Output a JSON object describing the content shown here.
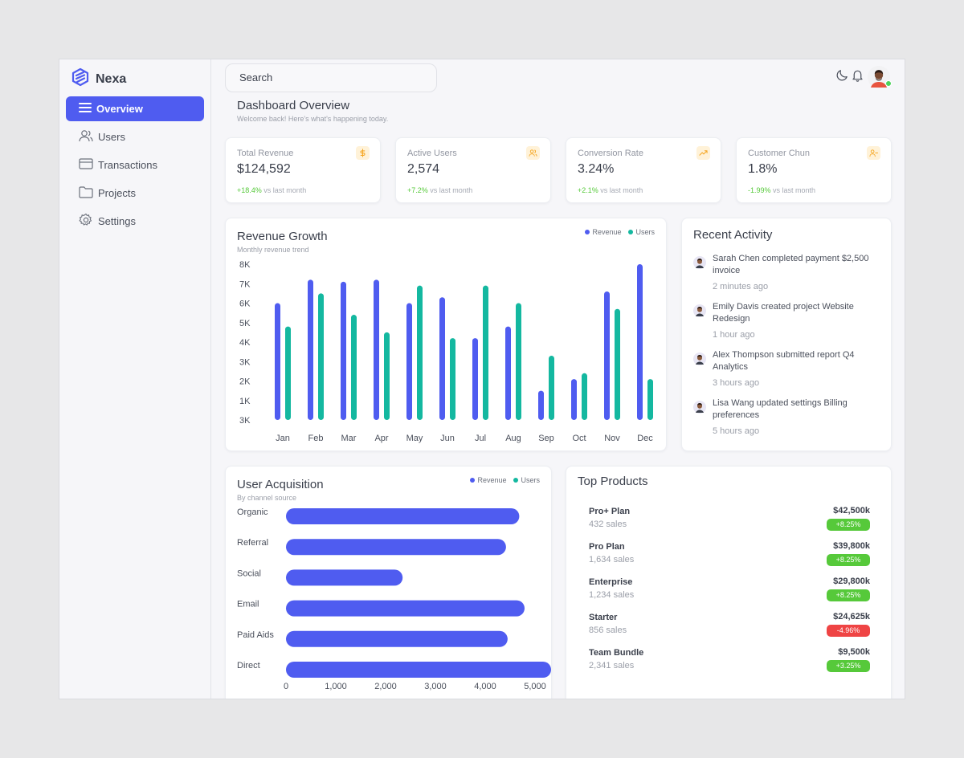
{
  "app": {
    "name": "Nexa"
  },
  "sidebar": {
    "items": [
      {
        "label": "Overview",
        "icon": "menu-icon",
        "active": true
      },
      {
        "label": "Users",
        "icon": "users-icon"
      },
      {
        "label": "Transactions",
        "icon": "credit-card-icon"
      },
      {
        "label": "Projects",
        "icon": "folder-icon"
      },
      {
        "label": "Settings",
        "icon": "gear-icon"
      }
    ]
  },
  "header": {
    "search_placeholder": "Search",
    "icons": [
      "moon-icon",
      "bell-icon",
      "avatar"
    ]
  },
  "page": {
    "title": "Dashboard Overview",
    "subtitle": "Welcome back! Here's what's happening today."
  },
  "stats": [
    {
      "label": "Total Revenue",
      "value": "$124,592",
      "change": "+18.4%",
      "change_suffix": "vs last month",
      "icon": "dollar-icon"
    },
    {
      "label": "Active Users",
      "value": "2,574",
      "change": "+7.2%",
      "change_suffix": "vs last month",
      "icon": "users-icon"
    },
    {
      "label": "Conversion Rate",
      "value": "3.24%",
      "change": "+2.1%",
      "change_suffix": "vs last month",
      "icon": "trending-up-icon"
    },
    {
      "label": "Customer Chun",
      "value": "1.8%",
      "change": "-1.99%",
      "change_suffix": "vs last month",
      "icon": "user-minus-icon"
    }
  ],
  "revenue_chart": {
    "title": "Revenue Growth",
    "subtitle": "Monthly revenue trend",
    "legend": [
      "Revenue",
      "Users"
    ]
  },
  "acquisition_chart": {
    "title": "User Acquisition",
    "subtitle": "By channel source",
    "legend": [
      "Revenue",
      "Users"
    ]
  },
  "chart_data": [
    {
      "type": "bar",
      "title": "Revenue Growth",
      "subtitle": "Monthly revenue trend",
      "categories": [
        "Jan",
        "Feb",
        "Mar",
        "Apr",
        "May",
        "Jun",
        "Jul",
        "Aug",
        "Sep",
        "Oct",
        "Nov",
        "Dec"
      ],
      "y_tick_labels": [
        "8K",
        "7K",
        "6K",
        "5K",
        "4K",
        "3K",
        "2K",
        "1K",
        "3K"
      ],
      "ylim": [
        0,
        8000
      ],
      "series": [
        {
          "name": "Revenue",
          "color": "#4f5cf0",
          "values": [
            6000,
            7200,
            7100,
            7200,
            6000,
            6300,
            4200,
            4800,
            1500,
            2100,
            6600,
            8000
          ]
        },
        {
          "name": "Users",
          "color": "#14b8a0",
          "values": [
            4800,
            6500,
            5400,
            4500,
            6900,
            4200,
            6900,
            6000,
            3300,
            2400,
            5700,
            2100
          ]
        }
      ],
      "legend": "top-right",
      "grid": false
    },
    {
      "type": "bar",
      "orientation": "horizontal",
      "title": "User Acquisition",
      "subtitle": "By channel source",
      "categories": [
        "Organic",
        "Referral",
        "Social",
        "Email",
        "Paid Aids",
        "Direct"
      ],
      "values": [
        4400,
        4150,
        2200,
        4500,
        4180,
        5000
      ],
      "x_tick_labels": [
        "0",
        "1,000",
        "2,000",
        "3,000",
        "4,000",
        "5,000"
      ],
      "xlim": [
        0,
        5000
      ],
      "legend_entries": [
        "Revenue",
        "Users"
      ],
      "legend": "top-right",
      "grid": false
    }
  ],
  "activity": {
    "title": "Recent Activity",
    "items": [
      {
        "text": "Sarah Chen completed payment $2,500 invoice",
        "time": "2 minutes ago"
      },
      {
        "text": "Emily Davis created project Website Redesign",
        "time": "1 hour ago"
      },
      {
        "text": "Alex Thompson submitted report Q4 Analytics",
        "time": "3 hours ago"
      },
      {
        "text": "Lisa Wang updated settings Billing preferences",
        "time": "5 hours ago"
      }
    ]
  },
  "products": {
    "title": "Top Products",
    "items": [
      {
        "name": "Pro+ Plan",
        "sales": "432 sales",
        "amount": "$42,500k",
        "change": "+8.25%",
        "positive": true
      },
      {
        "name": "Pro Plan",
        "sales": "1,634 sales",
        "amount": "$39,800k",
        "change": "+8.25%",
        "positive": true
      },
      {
        "name": "Enterprise",
        "sales": "1,234 sales",
        "amount": "$29,800k",
        "change": "+8.25%",
        "positive": true
      },
      {
        "name": "Starter",
        "sales": "856 sales",
        "amount": "$24,625k",
        "change": "-4.96%",
        "positive": false
      },
      {
        "name": "Team Bundle",
        "sales": "2,341 sales",
        "amount": "$9,500k",
        "change": "+3.25%",
        "positive": true
      }
    ]
  },
  "colors": {
    "accent": "#4f5cf0",
    "teal": "#14b8a0",
    "positive": "#56c93a",
    "negative": "#ef4444"
  }
}
